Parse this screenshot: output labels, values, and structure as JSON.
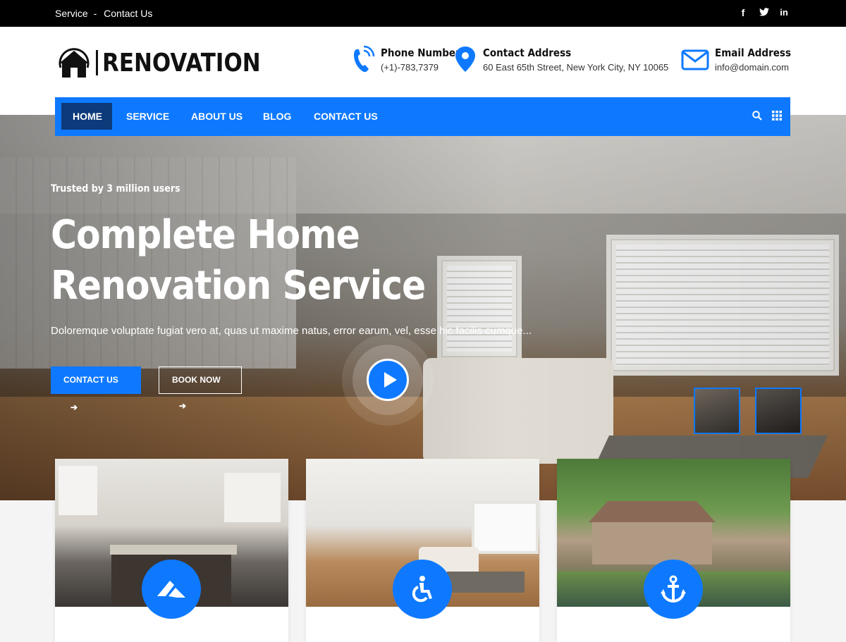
{
  "topbar": {
    "link_service": "Service",
    "separator": "-",
    "link_contact": "Contact Us",
    "social": [
      "facebook-icon",
      "twitter-icon",
      "linkedin-icon"
    ]
  },
  "logo": {
    "text": "RENOVATION"
  },
  "contacts": [
    {
      "title": "Phone Number",
      "value": "(+1)-783,7379",
      "icon": "phone-icon"
    },
    {
      "title": "Contact Address",
      "value": "60 East 65th Street, New York City, NY 10065",
      "icon": "location-icon"
    },
    {
      "title": "Email Address",
      "value": "info@domain.com",
      "icon": "envelope-icon"
    }
  ],
  "nav": {
    "items": [
      "HOME",
      "SERVICE",
      "ABOUT US",
      "BLOG",
      "CONTACT US"
    ],
    "active": "HOME"
  },
  "hero": {
    "kicker": "Trusted by 3 million users",
    "title": "Complete Home Renovation Service",
    "description": "Doloremque voluptate fugiat vero at, quas ut maxime natus, error earum, vel, esse hic facilis cumque...",
    "primary_button": "CONTACT US",
    "secondary_button": "BOOK NOW"
  },
  "cards": [
    {
      "icon": "roof-icon"
    },
    {
      "icon": "accessibility-icon"
    },
    {
      "icon": "anchor-icon"
    }
  ],
  "colors": {
    "accent": "#0e79ff",
    "nav_active": "#0c3a7a",
    "topbar": "#000000"
  }
}
